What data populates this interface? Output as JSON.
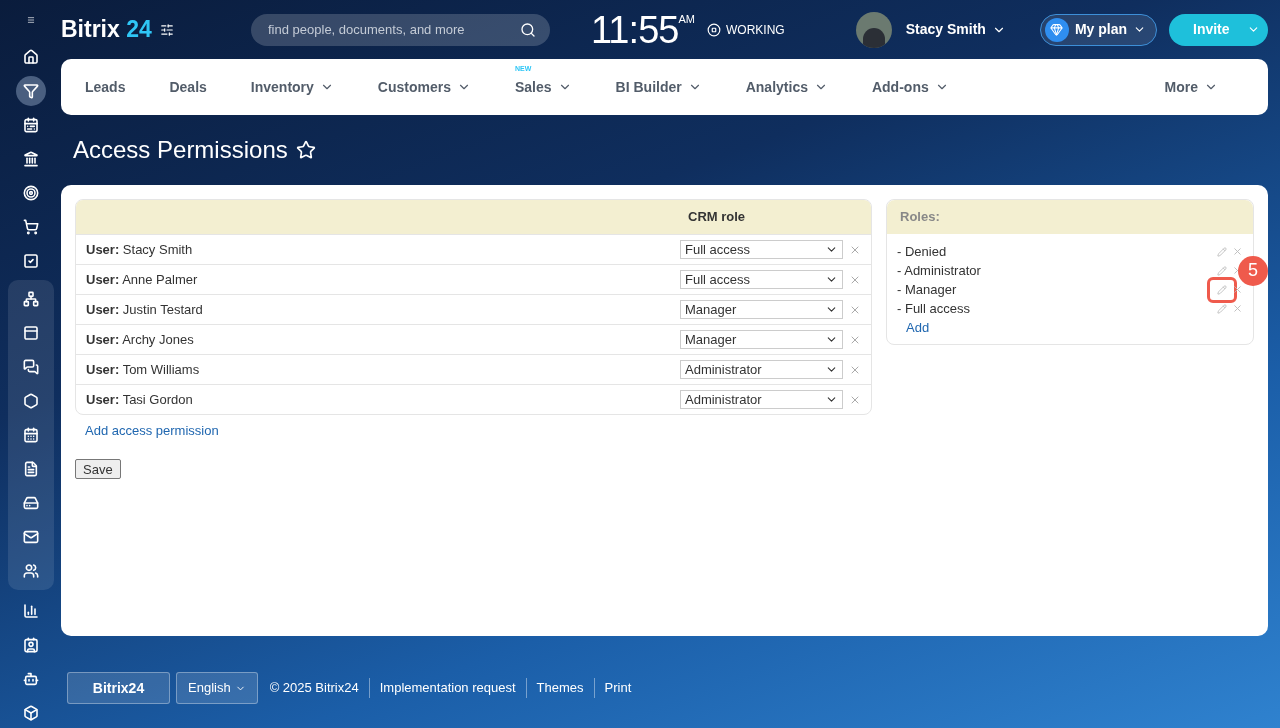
{
  "header": {
    "logo_word": "Bitrix",
    "logo_number": "24",
    "search": {
      "placeholder": "find people, documents, and more"
    },
    "clock": "11:55",
    "clock_suffix": "AM",
    "status": "WORKING",
    "user": "Stacy Smith",
    "plan_button": "My plan",
    "invite_button": "Invite"
  },
  "sidebar": {
    "top_items": [
      {
        "selected": false
      },
      {
        "selected": true
      },
      {
        "selected": false
      },
      {
        "selected": false
      },
      {
        "selected": false
      },
      {
        "selected": false
      },
      {
        "selected": false
      }
    ],
    "group_items": [
      {
        "selected": false
      },
      {
        "selected": false
      },
      {
        "selected": false
      },
      {
        "selected": false
      },
      {
        "selected": false
      },
      {
        "selected": false
      },
      {
        "selected": false
      },
      {
        "selected": false
      },
      {
        "selected": false
      }
    ],
    "bottom_items": [
      {
        "selected": false
      },
      {
        "selected": false
      },
      {
        "selected": false
      },
      {
        "selected": false
      }
    ]
  },
  "nav": {
    "items": [
      {
        "label": "Leads",
        "dropdown": false
      },
      {
        "label": "Deals",
        "dropdown": false
      },
      {
        "label": "Inventory",
        "dropdown": true
      },
      {
        "label": "Customers",
        "dropdown": true
      },
      {
        "label": "Sales",
        "dropdown": true,
        "badge": "NEW"
      },
      {
        "label": "BI Builder",
        "dropdown": true
      },
      {
        "label": "Analytics",
        "dropdown": true
      },
      {
        "label": "Add-ons",
        "dropdown": true
      }
    ],
    "more": "More"
  },
  "page_title": "Access Permissions",
  "permissions": {
    "column": "CRM role",
    "rows": [
      {
        "user": "**User:** Stacy Smith",
        "role": "Full access"
      },
      {
        "user": "**User:** Anne Palmer",
        "role": "Full access"
      },
      {
        "user": "**User:** Justin Testard",
        "role": "Manager"
      },
      {
        "user": "**User:** Archy Jones",
        "role": "Manager"
      },
      {
        "user": "**User:** Tom Williams",
        "role": "Administrator"
      },
      {
        "user": "**User:** Tasi Gordon",
        "role": "Administrator"
      }
    ],
    "add_link": "Add access permission",
    "save_button": "Save"
  },
  "roles": {
    "title": "Roles:",
    "items": [
      {
        "name": "- Denied",
        "highlighted": false
      },
      {
        "name": "- Administrator",
        "highlighted": false
      },
      {
        "name": "- Manager",
        "highlighted": true,
        "callout": "5"
      },
      {
        "name": "- Full access",
        "highlighted": false
      }
    ],
    "add_link": "Add"
  },
  "footer": {
    "logo": "Bitrix24",
    "language": "English",
    "links": [
      "© 2025 Bitrix24",
      "Implementation request",
      "Themes",
      "Print"
    ]
  }
}
